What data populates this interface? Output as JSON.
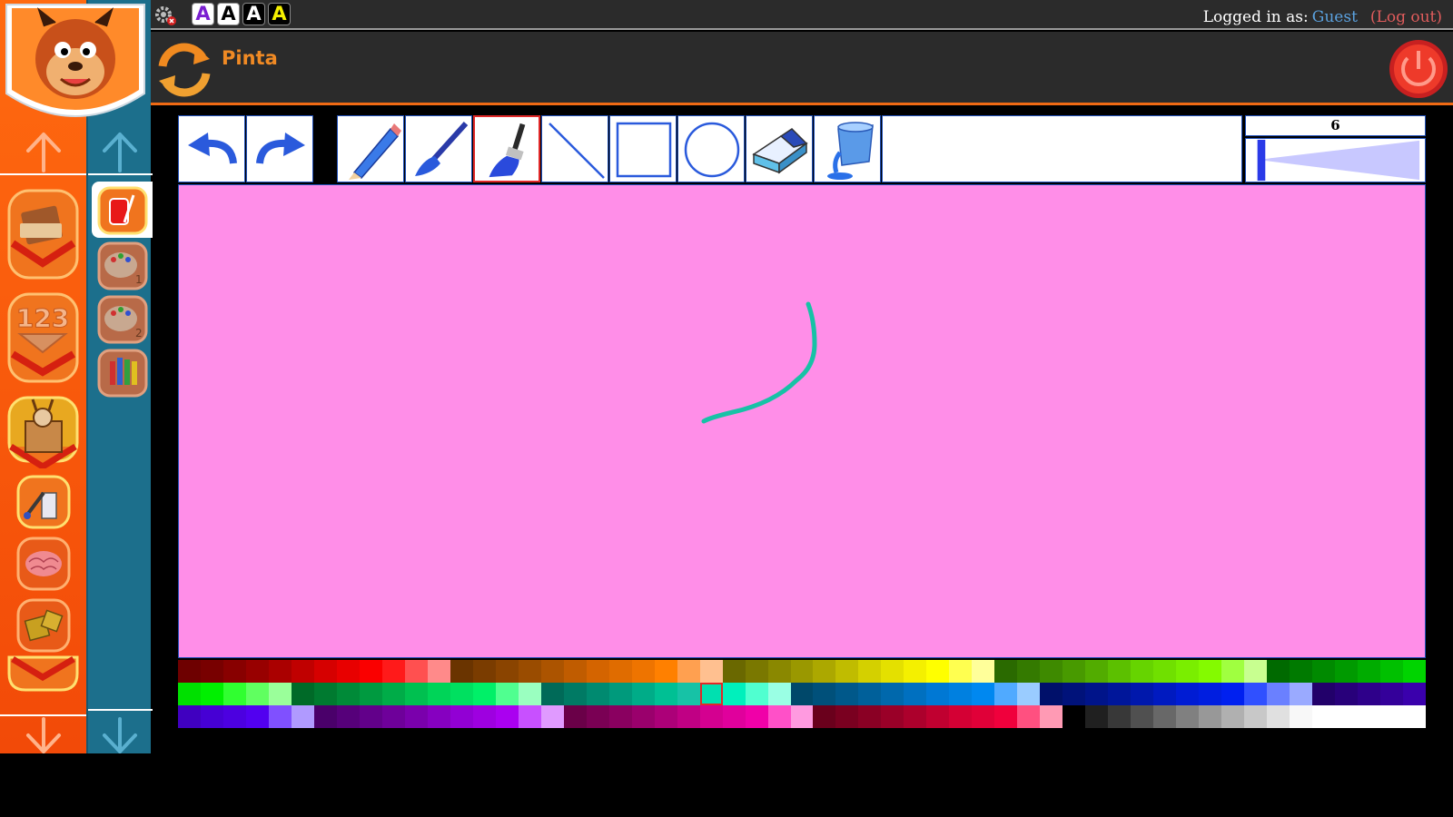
{
  "topbar": {
    "font_buttons": [
      {
        "label": "A",
        "bg": "#ffffff",
        "fg": "#7a1fd0"
      },
      {
        "label": "A",
        "bg": "#ffffff",
        "fg": "#000000"
      },
      {
        "label": "A",
        "bg": "#000000",
        "fg": "#ffffff"
      },
      {
        "label": "A",
        "bg": "#000000",
        "fg": "#f5f000"
      }
    ],
    "login_prefix": "Logged in as:",
    "user": "Guest",
    "logout": "(Log out)"
  },
  "header": {
    "title": "Pinta"
  },
  "toolbar": {
    "tools": [
      "undo",
      "redo",
      "pencil",
      "brush",
      "paint-brush",
      "line",
      "rectangle",
      "circle",
      "eraser",
      "fill-bucket"
    ],
    "selected_tool": "paint-brush",
    "brush_size": "6"
  },
  "colors": {
    "accent": "#f06a14",
    "canvas": "#ff8ee8",
    "stroke": "#17c2a6",
    "selection": "#e02828"
  },
  "palette": {
    "selected_index": 78,
    "rows": [
      [
        "#6e0000",
        "#780000",
        "#880000",
        "#980000",
        "#aa0000",
        "#c00000",
        "#d60000",
        "#e80000",
        "#fa0000",
        "#ff1a1a",
        "#ff5050",
        "#ff8a8a",
        "#6a3400",
        "#7a3c00",
        "#8a4400",
        "#9a4c00",
        "#ac5400",
        "#c05c00",
        "#d46400",
        "#e06c00",
        "#ee7400",
        "#ff8000",
        "#ffa050",
        "#ffc090",
        "#6a6800",
        "#7a7800",
        "#8a8800",
        "#9a9800",
        "#aca800",
        "#c0bc00",
        "#d4d000",
        "#e4e000",
        "#f4f000",
        "#ffff00",
        "#ffff50",
        "#ffff9a",
        "#2a6a00",
        "#347a00",
        "#3e8a00",
        "#489a00",
        "#52ac00",
        "#5cc000",
        "#66d400",
        "#70e000",
        "#7aee00",
        "#84fa00",
        "#a0ff40",
        "#c8ff90",
        "#006a00",
        "#007a00",
        "#008a00",
        "#009a00",
        "#00ac00",
        "#00c000",
        "#00d400"
      ],
      [
        "#00e000",
        "#00f000",
        "#30ff30",
        "#60ff60",
        "#9aff9a",
        "#006a28",
        "#007a30",
        "#008a38",
        "#009a40",
        "#00ac48",
        "#00c050",
        "#00d458",
        "#00e060",
        "#00f068",
        "#50ff90",
        "#9affc0",
        "#006a58",
        "#007a64",
        "#008a70",
        "#009a7c",
        "#00ac88",
        "#00c094",
        "#17c2a6",
        "#00e0b0",
        "#00f0bc",
        "#50ffd0",
        "#9affe4",
        "#00486a",
        "#00507a",
        "#00588a",
        "#00609a",
        "#0068ac",
        "#0070c0",
        "#0078d4",
        "#0080e0",
        "#0088f0",
        "#50aaff",
        "#9accff",
        "#00106a",
        "#00127a",
        "#00148a",
        "#00169a",
        "#0018ac",
        "#001ac0",
        "#001cd4",
        "#001ee0",
        "#0020f0",
        "#3050ff",
        "#6a80ff",
        "#9aaaff",
        "#22006a",
        "#28007a",
        "#2e008a",
        "#34009a",
        "#3a00ac"
      ],
      [
        "#4000c0",
        "#4600d4",
        "#4c00e0",
        "#5200f0",
        "#8050ff",
        "#b09aff",
        "#4a006a",
        "#56007a",
        "#62008a",
        "#6e009a",
        "#7a00ac",
        "#8600c0",
        "#9200d4",
        "#9e00e0",
        "#aa00f0",
        "#c850ff",
        "#e09aff",
        "#6a0048",
        "#7a0054",
        "#8a0060",
        "#9a006c",
        "#ac0078",
        "#c00084",
        "#d40090",
        "#e0009c",
        "#f000a8",
        "#ff50c8",
        "#ff9ae0",
        "#6a001c",
        "#7a0020",
        "#8a0024",
        "#9a0028",
        "#ac002c",
        "#c00030",
        "#d40034",
        "#e00038",
        "#f0003c",
        "#ff5080",
        "#ff9ab4",
        "#000000",
        "#202020",
        "#383838",
        "#505050",
        "#686868",
        "#808080",
        "#989898",
        "#b0b0b0",
        "#c8c8c8",
        "#e0e0e0",
        "#f8f8f8",
        "#ffffff",
        "#ffffff",
        "#ffffff",
        "#ffffff",
        "#ffffff"
      ]
    ]
  }
}
